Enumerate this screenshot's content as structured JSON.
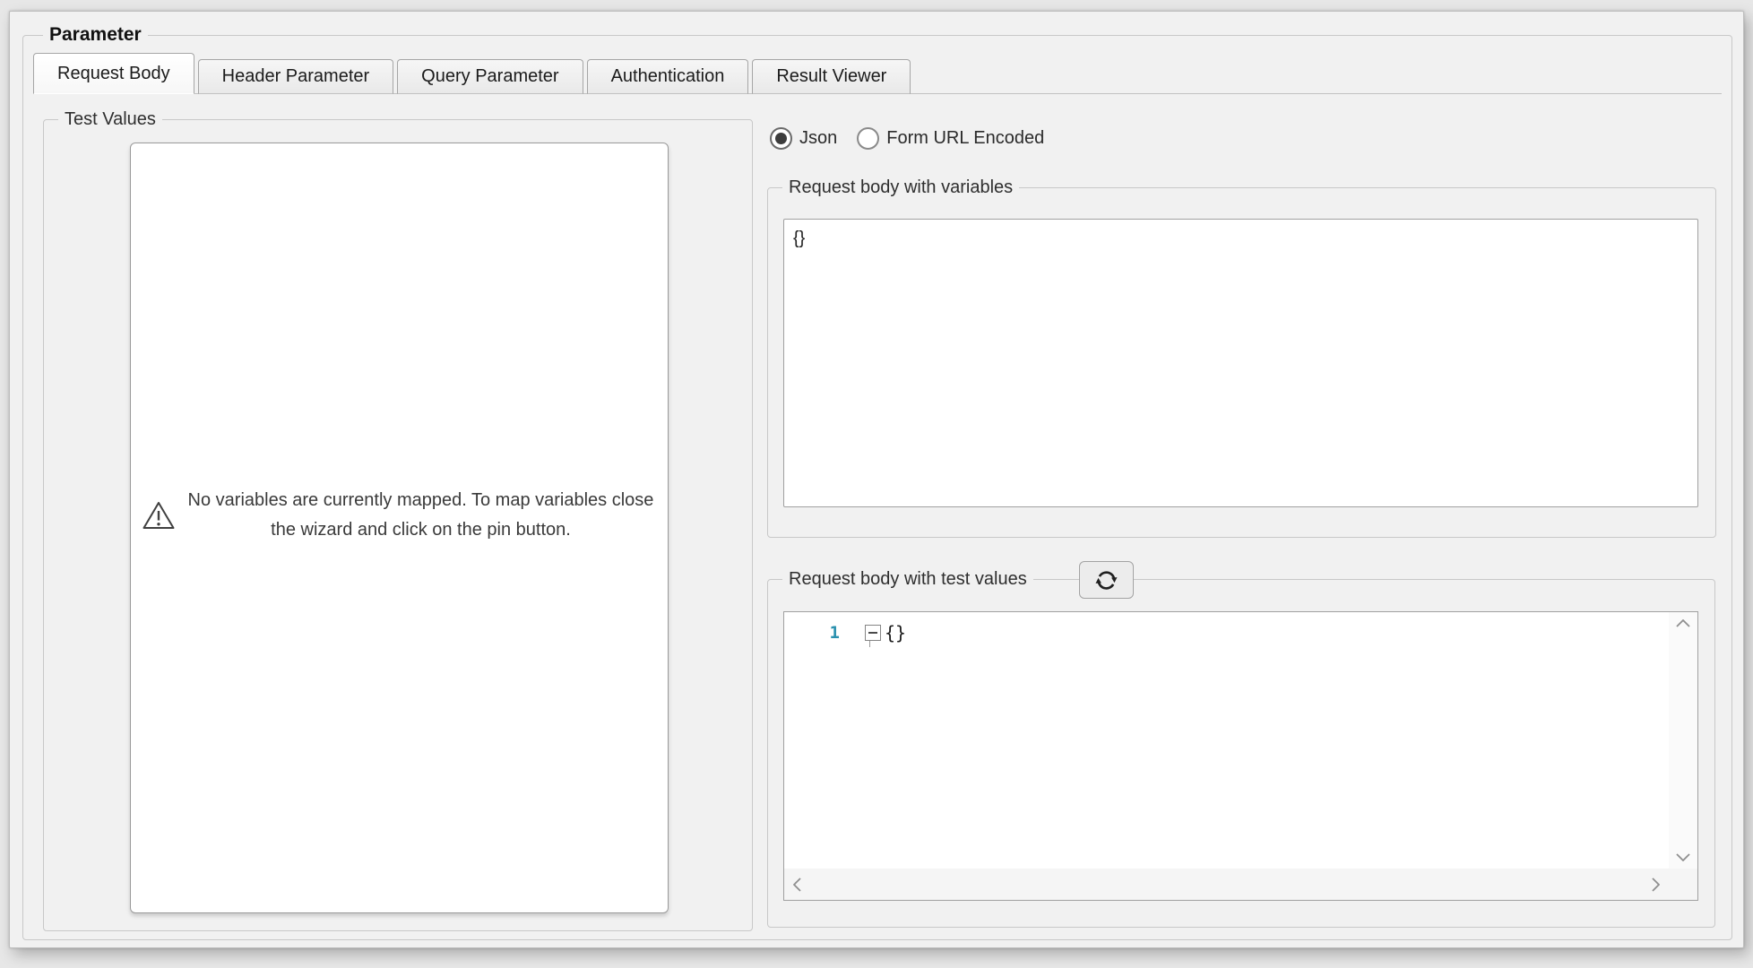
{
  "group_title": "Parameter",
  "tabs": [
    {
      "label": "Request Body",
      "active": true
    },
    {
      "label": "Header Parameter",
      "active": false
    },
    {
      "label": "Query Parameter",
      "active": false
    },
    {
      "label": "Authentication",
      "active": false
    },
    {
      "label": "Result Viewer",
      "active": false
    }
  ],
  "test_values": {
    "group_label": "Test Values",
    "empty_message": "No variables are currently mapped. To map variables close the wizard and click on the pin button."
  },
  "body_format": {
    "json_label": "Json",
    "form_label": "Form URL Encoded",
    "selected": "Json"
  },
  "body_with_variables": {
    "group_label": "Request body with variables",
    "content": "{}"
  },
  "body_with_test_values": {
    "group_label": "Request body with test values",
    "line_number": "1",
    "content": "{}"
  },
  "icons": {
    "warning": "triangle-exclamation",
    "refresh": "circular-arrows",
    "scroll_up": "chevron-up",
    "scroll_down": "chevron-down",
    "scroll_left": "chevron-left",
    "scroll_right": "chevron-right"
  },
  "colors": {
    "line_number_blue": "#2B91AF",
    "window_background": "#f1f1f1",
    "panel_border": "#9a9a9a"
  }
}
